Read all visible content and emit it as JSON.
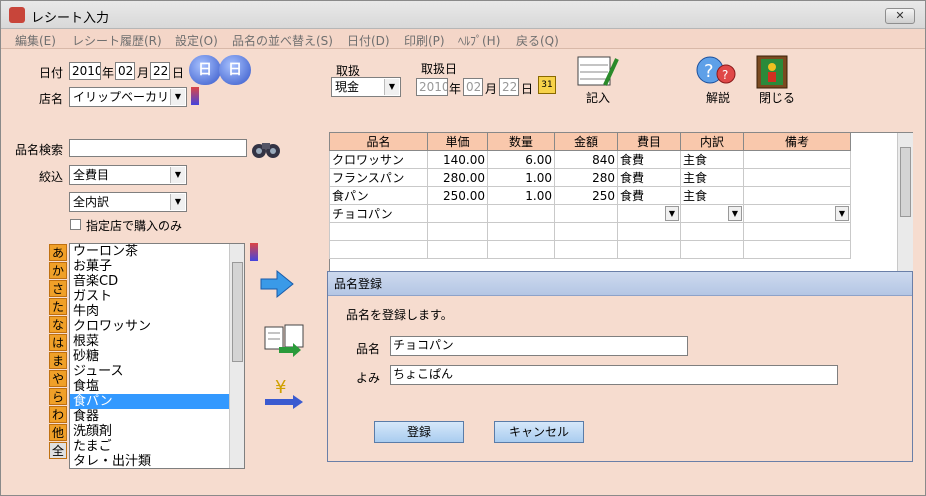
{
  "window": {
    "title": "レシート入力",
    "close_label": "✕"
  },
  "menu": [
    "編集(E)",
    "レシート履歴(R)",
    "設定(O)",
    "品名の並べ替え(S)",
    "日付(D)",
    "印刷(P)",
    "ﾍﾙﾌﾟ(H)",
    "戻る(Q)"
  ],
  "header": {
    "date_label": "日付",
    "year": "2010",
    "year_unit": "年",
    "month": "02",
    "month_unit": "月",
    "day": "22",
    "day_unit": "日",
    "prev_day": "日",
    "next_day": "日",
    "store_label": "店名",
    "store_value": "イリップベーカリー",
    "handling_label": "取扱",
    "handling_value": "現金",
    "handling_date_label": "取扱日",
    "hdate_year": "2010",
    "hdate_month": "02",
    "hdate_day": "22",
    "record_label": "記入",
    "help_label": "解説",
    "close_label": "閉じる"
  },
  "search": {
    "label": "品名検索",
    "value": "",
    "filter_label": "絞込",
    "filter1": "全費目",
    "filter2": "全内訳",
    "only_store_label": "指定店で購入のみ"
  },
  "kana": [
    "あ",
    "か",
    "さ",
    "た",
    "な",
    "は",
    "ま",
    "や",
    "ら",
    "わ",
    "他",
    "全"
  ],
  "items": [
    "ウーロン茶",
    "お菓子",
    "音楽CD",
    "ガスト",
    "牛肉",
    "クロワッサン",
    "根菜",
    "砂糖",
    "ジュース",
    "食塩",
    "食パン",
    "食器",
    "洗顔剤",
    "たまご",
    "タレ・出汁類"
  ],
  "selected_item": "食パン",
  "grid": {
    "headers": [
      "品名",
      "単価",
      "数量",
      "金額",
      "費目",
      "内訳",
      "備考"
    ],
    "rows": [
      [
        "クロワッサン",
        "140.00",
        "6.00",
        "840",
        "食費",
        "主食",
        ""
      ],
      [
        "フランスパン",
        "280.00",
        "1.00",
        "280",
        "食費",
        "主食",
        ""
      ],
      [
        "食パン",
        "250.00",
        "1.00",
        "250",
        "食費",
        "主食",
        ""
      ],
      [
        "チョコパン",
        "",
        "",
        "",
        "",
        "",
        ""
      ]
    ]
  },
  "dialog": {
    "title": "品名登録",
    "message": "品名を登録します。",
    "name_label": "品名",
    "name_value": "チョコパン",
    "reading_label": "よみ",
    "reading_value": "ちょこぱん",
    "ok_label": "登録",
    "cancel_label": "キャンセル"
  },
  "colors": {
    "background": "#f6dccf",
    "header": "#f9c8ac",
    "kana": "#f0a028",
    "selection": "#3399ff"
  }
}
